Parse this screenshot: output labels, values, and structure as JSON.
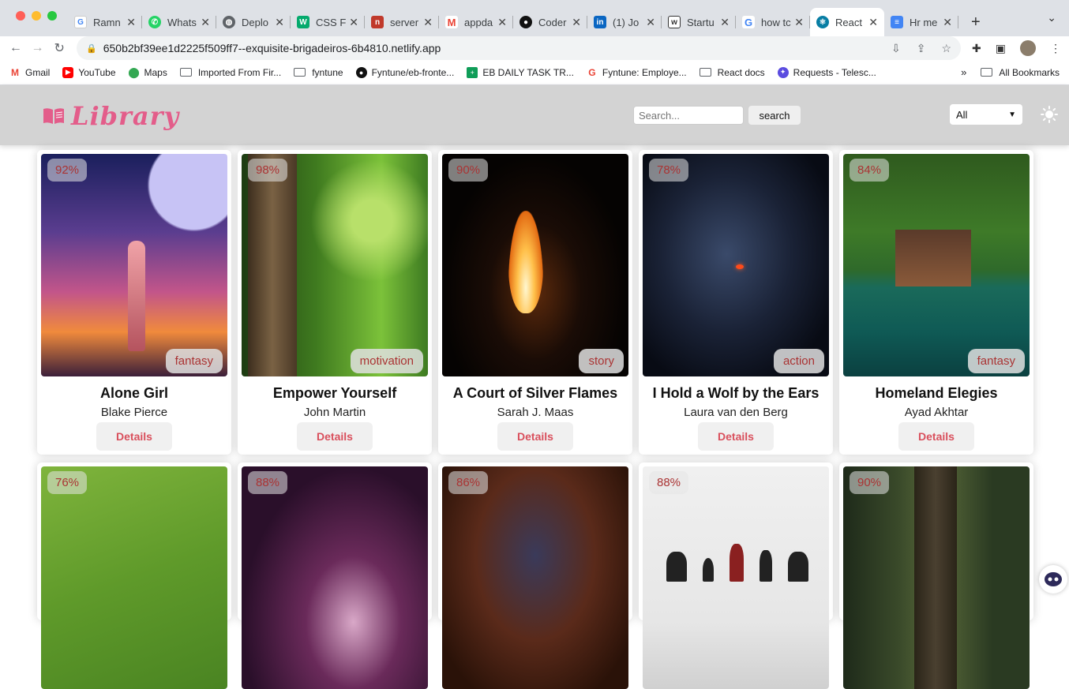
{
  "browser": {
    "tabs": [
      {
        "title": "Ramn",
        "icon": "google-icon",
        "color": "#ffffff"
      },
      {
        "title": "Whats",
        "icon": "whatsapp-icon",
        "color": "#25d366"
      },
      {
        "title": "Deplo",
        "icon": "globe-icon",
        "color": "#5f6368"
      },
      {
        "title": "CSS F",
        "icon": "w3-icon",
        "color": "#04aa6d"
      },
      {
        "title": "server",
        "icon": "netlify-icon",
        "color": "#c0392b"
      },
      {
        "title": "appda",
        "icon": "gmail-icon",
        "color": "#ea4335"
      },
      {
        "title": "Coder",
        "icon": "github-icon",
        "color": "#111111"
      },
      {
        "title": "(1) Jo",
        "icon": "linkedin-icon",
        "color": "#0a66c2"
      },
      {
        "title": "Startu",
        "icon": "w-icon",
        "color": "#333333"
      },
      {
        "title": "how tc",
        "icon": "google-icon",
        "color": "#4285f4"
      },
      {
        "title": "React",
        "icon": "react-icon",
        "color": "#087ea4"
      },
      {
        "title": "Hr me",
        "icon": "docs-icon",
        "color": "#4285f4"
      }
    ],
    "new_tab": "+",
    "url": "650b2bf39ee1d2225f509ff7--exquisite-brigadeiros-6b4810.netlify.app",
    "bookmarks": [
      {
        "label": "Gmail",
        "icon": "gmail-icon",
        "color": "#ea4335"
      },
      {
        "label": "YouTube",
        "icon": "youtube-icon",
        "color": "#ff0000"
      },
      {
        "label": "Maps",
        "icon": "maps-icon",
        "color": "#34a853"
      },
      {
        "label": "Imported From Fir...",
        "icon": "folder-icon"
      },
      {
        "label": "fyntune",
        "icon": "folder-icon"
      },
      {
        "label": "Fyntune/eb-fronte...",
        "icon": "github-icon",
        "color": "#111111"
      },
      {
        "label": "EB DAILY TASK TR...",
        "icon": "sheets-icon",
        "color": "#0f9d58"
      },
      {
        "label": "Fyntune: Employe...",
        "icon": "google-icon",
        "color": "#ea4335"
      },
      {
        "label": "React docs",
        "icon": "folder-icon"
      },
      {
        "label": "Requests - Telesc...",
        "icon": "telescope-icon",
        "color": "#5b4ce0"
      }
    ],
    "all_bookmarks": "All Bookmarks",
    "overflow": "»"
  },
  "app": {
    "logo_text": "Library",
    "brand_color": "#e35d8a",
    "search_placeholder": "Search...",
    "search_button": "search",
    "filter_value": "All",
    "theme_icon": "sun-icon"
  },
  "books": [
    {
      "percent": "92%",
      "genre": "fantasy",
      "title": "Alone Girl",
      "author": "Blake Pierce",
      "details": "Details"
    },
    {
      "percent": "98%",
      "genre": "motivation",
      "title": "Empower Yourself",
      "author": "John Martin",
      "details": "Details"
    },
    {
      "percent": "90%",
      "genre": "story",
      "title": "A Court of Silver Flames",
      "author": "Sarah J. Maas",
      "details": "Details"
    },
    {
      "percent": "78%",
      "genre": "action",
      "title": "I Hold a Wolf by the Ears",
      "author": "Laura van den Berg",
      "details": "Details"
    },
    {
      "percent": "84%",
      "genre": "fantasy",
      "title": "Homeland Elegies",
      "author": "Ayad Akhtar",
      "details": "Details"
    },
    {
      "percent": "76%"
    },
    {
      "percent": "88%"
    },
    {
      "percent": "86%"
    },
    {
      "percent": "88%"
    },
    {
      "percent": "90%"
    }
  ]
}
